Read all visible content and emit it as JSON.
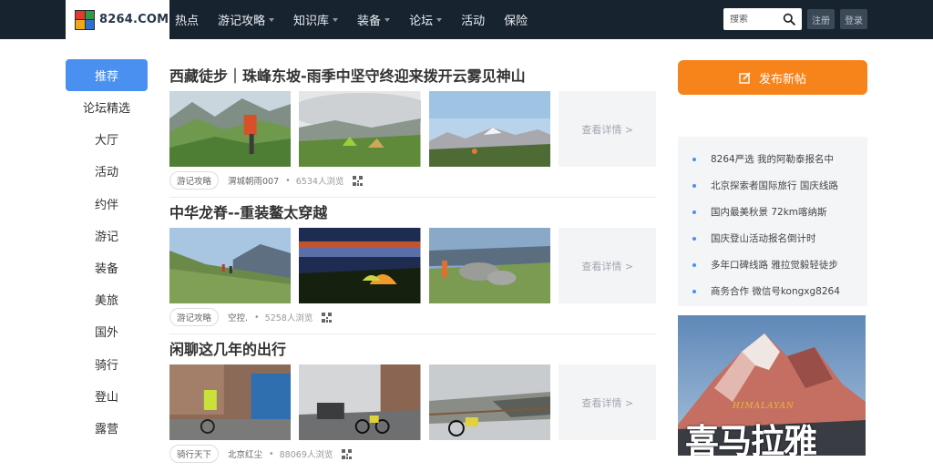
{
  "brand": {
    "name": "8264.COM"
  },
  "nav": [
    {
      "label": "热点",
      "caret": false
    },
    {
      "label": "游记攻略",
      "caret": true
    },
    {
      "label": "知识库",
      "caret": true
    },
    {
      "label": "装备",
      "caret": true
    },
    {
      "label": "论坛",
      "caret": true
    },
    {
      "label": "活动",
      "caret": false
    },
    {
      "label": "保险",
      "caret": false
    }
  ],
  "search": {
    "placeholder": "搜索"
  },
  "auth": {
    "register": "注册",
    "login": "登录"
  },
  "sidebar": {
    "items": [
      {
        "label": "推荐",
        "active": true
      },
      {
        "label": "论坛精选"
      },
      {
        "label": "大厅"
      },
      {
        "label": "活动"
      },
      {
        "label": "约伴"
      },
      {
        "label": "游记"
      },
      {
        "label": "装备"
      },
      {
        "label": "美旅"
      },
      {
        "label": "国外"
      },
      {
        "label": "骑行"
      },
      {
        "label": "登山"
      },
      {
        "label": "露营"
      }
    ]
  },
  "feed": {
    "more_label": "查看详情 >",
    "posts": [
      {
        "title": "西藏徒步｜珠峰东坡-雨季中坚守终迎来拨开云雾见神山",
        "tag": "游记攻略",
        "author": "渭城朝雨007",
        "views": "6534人浏览"
      },
      {
        "title": "中华龙脊--重装鳌太穿越",
        "tag": "游记攻略",
        "author": "空控.",
        "views": "5258人浏览"
      },
      {
        "title": "闲聊这几年的出行",
        "tag": "骑行天下",
        "author": "北京红尘",
        "views": "88069人浏览"
      }
    ]
  },
  "right": {
    "post_button": "发布新帖",
    "notices": [
      "8264严选 我的阿勒泰报名中",
      "北京探索者国际旅行 国庆线路",
      "国内最美秋景 72km喀纳斯",
      "国庆登山活动报名倒计时",
      "多年口碑线路 雅拉觉毅轻徒步",
      "商务合作 微信号kongxg8264"
    ],
    "banner": {
      "title_en": "HIMALAYAN",
      "title_cn": "喜马拉雅"
    }
  },
  "colors": {
    "header": "#17232f",
    "active": "#4a90f0",
    "post_button": "#f7841b"
  }
}
